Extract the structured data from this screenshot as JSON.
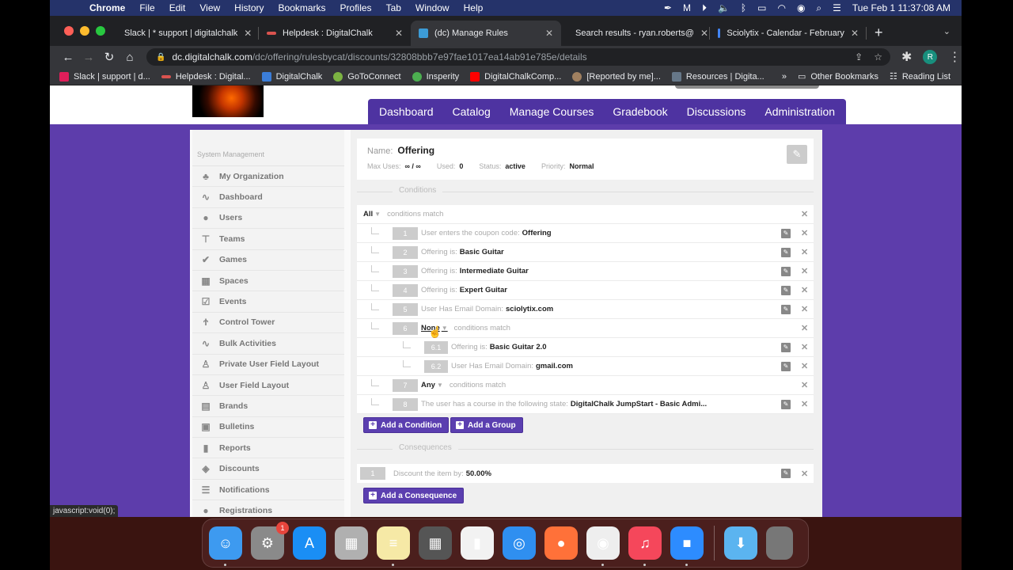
{
  "menubar": {
    "app": "Chrome",
    "items": [
      "File",
      "Edit",
      "View",
      "History",
      "Bookmarks",
      "Profiles",
      "Tab",
      "Window",
      "Help"
    ],
    "clock": "Tue Feb 1  11:37:08 AM"
  },
  "browser": {
    "tabs": [
      {
        "title": "Slack | * support | digitalchalk",
        "color": "#e01e5a",
        "active": false
      },
      {
        "title": "Helpdesk : DigitalChalk",
        "color": "#d9534f",
        "active": false
      },
      {
        "title": "(dc) Manage Rules",
        "color": "#3c9bd6",
        "active": true
      },
      {
        "title": "Search results - ryan.roberts@",
        "color": "#ea4335",
        "active": false
      },
      {
        "title": "Sciolytix - Calendar - February",
        "color": "#4285f4",
        "active": false
      }
    ],
    "url_host": "dc.digitalchalk.com",
    "url_path": "/dc/offering/rulesbycat/discounts/32808bbb7e97fae1017ea14ab91e785e/details",
    "profile_initial": "R",
    "bookmarks": [
      {
        "label": "Slack | support | d...",
        "color": "#e01e5a"
      },
      {
        "label": "Helpdesk : Digital...",
        "color": "#d9534f"
      },
      {
        "label": "DigitalChalk",
        "color": "#3b7dd8"
      },
      {
        "label": "GoToConnect",
        "color": "#7cb342"
      },
      {
        "label": "Insperity",
        "color": "#4caf50"
      },
      {
        "label": "DigitalChalkComp...",
        "color": "#ff0000"
      },
      {
        "label": "[Reported by me]...",
        "color": "#a08060"
      },
      {
        "label": "Resources | Digita...",
        "color": "#667788"
      }
    ],
    "more_label": "»",
    "other_bookmarks": "Other Bookmarks",
    "reading_list": "Reading List"
  },
  "nav": {
    "items": [
      "Dashboard",
      "Catalog",
      "Manage Courses",
      "Gradebook",
      "Discussions",
      "Administration"
    ]
  },
  "sidebar": {
    "heading": "System Management",
    "items": [
      {
        "label": "My Organization",
        "icon": "org-chart-icon",
        "glyph": "♣"
      },
      {
        "label": "Dashboard",
        "icon": "pulse-icon",
        "glyph": "∿"
      },
      {
        "label": "Users",
        "icon": "user-icon",
        "glyph": "●"
      },
      {
        "label": "Teams",
        "icon": "hierarchy-icon",
        "glyph": "⊤"
      },
      {
        "label": "Games",
        "icon": "check-circle-icon",
        "glyph": "✔"
      },
      {
        "label": "Spaces",
        "icon": "grid-icon",
        "glyph": "▦"
      },
      {
        "label": "Events",
        "icon": "calendar-icon",
        "glyph": "☑"
      },
      {
        "label": "Control Tower",
        "icon": "tower-icon",
        "glyph": "Ϯ"
      },
      {
        "label": "Bulk Activities",
        "icon": "pulse-icon",
        "glyph": "∿"
      },
      {
        "label": "Private User Field Layout",
        "icon": "user-outline-icon",
        "glyph": "♙"
      },
      {
        "label": "User Field Layout",
        "icon": "user-outline-icon",
        "glyph": "♙"
      },
      {
        "label": "Brands",
        "icon": "brand-icon",
        "glyph": "▤"
      },
      {
        "label": "Bulletins",
        "icon": "clipboard-icon",
        "glyph": "▣"
      },
      {
        "label": "Reports",
        "icon": "bar-chart-icon",
        "glyph": "▮"
      },
      {
        "label": "Discounts",
        "icon": "tag-icon",
        "glyph": "◈"
      },
      {
        "label": "Notifications",
        "icon": "message-icon",
        "glyph": "☰"
      },
      {
        "label": "Registrations",
        "icon": "user-add-icon",
        "glyph": "●"
      }
    ]
  },
  "rule": {
    "name_label": "Name:",
    "name": "Offering",
    "max_uses_label": "Max Uses:",
    "max_uses": "∞ / ∞",
    "used_label": "Used:",
    "used": "0",
    "status_label": "Status:",
    "status": "active",
    "priority_label": "Priority:",
    "priority": "Normal"
  },
  "conditions": {
    "section_label": "Conditions",
    "root_selector": "All",
    "root_text": "conditions match",
    "rows": [
      {
        "num": "1",
        "text": "User enters the coupon code:",
        "value": "Offering"
      },
      {
        "num": "2",
        "text": "Offering is:",
        "value": "Basic Guitar"
      },
      {
        "num": "3",
        "text": "Offering is:",
        "value": "Intermediate Guitar"
      },
      {
        "num": "4",
        "text": "Offering is:",
        "value": "Expert Guitar"
      },
      {
        "num": "5",
        "text": "User Has Email Domain:",
        "value": "sciolytix.com"
      }
    ],
    "group6": {
      "num": "6",
      "selector": "None",
      "text": "conditions match",
      "children": [
        {
          "num": "6.1",
          "text": "Offering is:",
          "value": "Basic Guitar 2.0"
        },
        {
          "num": "6.2",
          "text": "User Has Email Domain:",
          "value": "gmail.com"
        }
      ]
    },
    "group7": {
      "num": "7",
      "selector": "Any",
      "text": "conditions match"
    },
    "row8": {
      "num": "8",
      "text": "The user has a course in the following state:",
      "value": "DigitalChalk JumpStart - Basic Admi..."
    },
    "add_condition": "Add a Condition",
    "add_group": "Add a Group"
  },
  "consequences": {
    "section_label": "Consequences",
    "rows": [
      {
        "num": "1",
        "text": "Discount the item by:",
        "value": "50.00%"
      }
    ],
    "add_consequence": "Add a Consequence"
  },
  "status_url": "javascript:void(0);",
  "dock": {
    "apps": [
      {
        "name": "Finder",
        "icon": "finder-icon",
        "color": "#3d9af0",
        "glyph": "☺",
        "running": true
      },
      {
        "name": "System Preferences",
        "icon": "settings-icon",
        "color": "#8a8a8a",
        "glyph": "⚙",
        "badge": "1",
        "running": false
      },
      {
        "name": "App Store",
        "icon": "app-store-icon",
        "color": "#1a8ef5",
        "glyph": "A",
        "running": false
      },
      {
        "name": "Launchpad",
        "icon": "launchpad-icon",
        "color": "#b0b0b0",
        "glyph": "▦",
        "running": false
      },
      {
        "name": "Notes",
        "icon": "notes-icon",
        "color": "#f6e9a6",
        "glyph": "≡",
        "running": true
      },
      {
        "name": "Calculator",
        "icon": "calculator-icon",
        "color": "#555",
        "glyph": "▦",
        "running": false
      },
      {
        "name": "Numbers",
        "icon": "numbers-icon",
        "color": "#f2f2f2",
        "glyph": "▮",
        "running": false
      },
      {
        "name": "Safari",
        "icon": "safari-icon",
        "color": "#2f8ff0",
        "glyph": "◎",
        "running": false
      },
      {
        "name": "Firefox",
        "icon": "firefox-icon",
        "color": "#ff7139",
        "glyph": "●",
        "running": false
      },
      {
        "name": "Chrome",
        "icon": "chrome-icon",
        "color": "#eee",
        "glyph": "◉",
        "running": true
      },
      {
        "name": "Music",
        "icon": "music-icon",
        "color": "#f5475b",
        "glyph": "♫",
        "running": true
      },
      {
        "name": "Zoom",
        "icon": "zoom-icon",
        "color": "#2d8cff",
        "glyph": "■",
        "running": true
      }
    ],
    "downloads": {
      "name": "Downloads",
      "color": "#5bb4f0",
      "glyph": "⬇"
    },
    "trash": {
      "name": "Trash",
      "color": "#777",
      "glyph": "🗑"
    }
  }
}
